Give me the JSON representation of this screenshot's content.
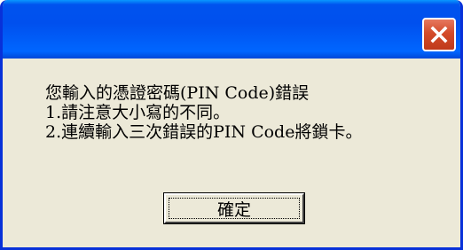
{
  "dialog": {
    "title": "",
    "close_icon": "close-x-icon",
    "messages": [
      "您輸入的憑證密碼(PIN Code)錯誤",
      "1.請注意大小寫的不同。",
      "2.連續輸入三次錯誤的PIN Code將鎖卡。"
    ],
    "ok_label": "確定"
  },
  "colors": {
    "titlebar": "#0050ee",
    "close_button": "#d34b2a",
    "dialog_background": "#ece9d8"
  }
}
